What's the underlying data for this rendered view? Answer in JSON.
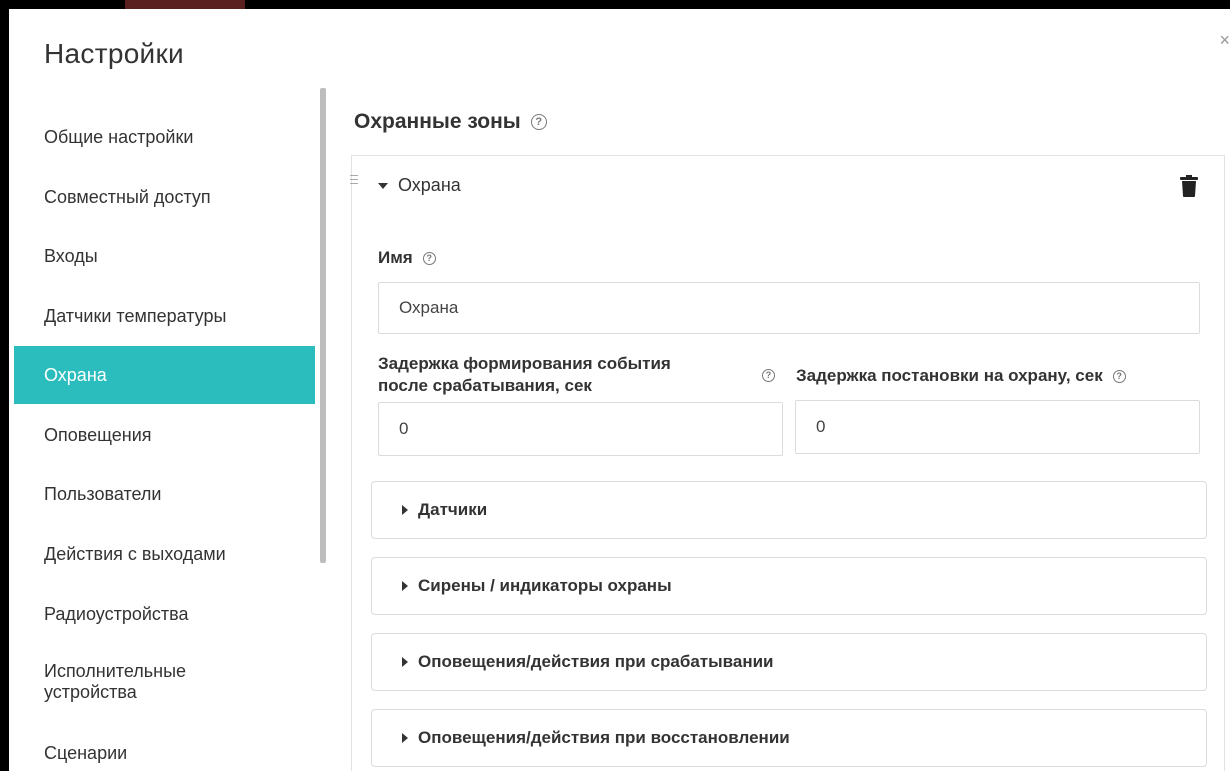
{
  "dialog": {
    "title": "Настройки",
    "close": "×"
  },
  "sidebar": {
    "items": [
      {
        "label": "Общие настройки"
      },
      {
        "label": "Совместный доступ"
      },
      {
        "label": "Входы"
      },
      {
        "label": "Датчики температуры"
      },
      {
        "label": "Охрана",
        "active": true
      },
      {
        "label": "Оповещения"
      },
      {
        "label": "Пользователи"
      },
      {
        "label": "Действия с выходами"
      },
      {
        "label": "Радиоустройства"
      },
      {
        "label_line1": "Исполнительные",
        "label_line2": "устройства"
      },
      {
        "label": "Сценарии"
      }
    ]
  },
  "main": {
    "title": "Охранные зоны",
    "help": "?",
    "zone": {
      "name": "Охрана",
      "name_label": "Имя",
      "name_value": "Охрана",
      "delay_event_label_line1": "Задержка формирования события",
      "delay_event_label_line2": "после срабатывания, сек",
      "delay_event_value": "0",
      "delay_arm_label": "Задержка постановки на охрану, сек",
      "delay_arm_value": "0",
      "sections": [
        {
          "label": "Датчики"
        },
        {
          "label": "Сирены / индикаторы охраны"
        },
        {
          "label": "Оповещения/действия при срабатывании"
        },
        {
          "label": "Оповещения/действия при восстановлении"
        }
      ]
    }
  },
  "colors": {
    "accent": "#2bbdbd",
    "border": "#dcdcdc",
    "text": "#333333"
  },
  "icons": {
    "help": "help-circle-icon",
    "trash": "trash-icon",
    "drag": "drag-handle-icon",
    "caret_down": "caret-down-icon",
    "caret_right": "caret-right-icon",
    "close": "close-icon"
  }
}
